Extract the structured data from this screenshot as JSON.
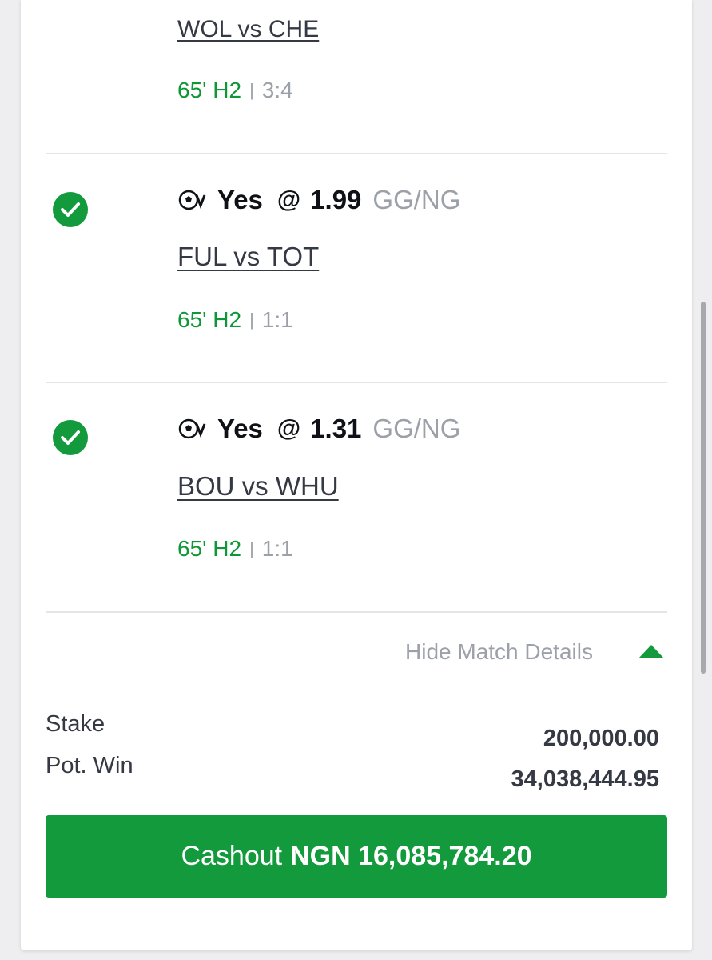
{
  "top_bet": {
    "match": "WOL vs CHE",
    "time": "65' H2",
    "score": "3:4"
  },
  "bets": [
    {
      "status_icon": "check-circle-icon",
      "sport_icon": "football-virtual-icon",
      "pick": "Yes",
      "at": "@",
      "odds": "1.99",
      "market": "GG/NG",
      "match": "FUL vs TOT",
      "time": "65' H2",
      "score": "1:1"
    },
    {
      "status_icon": "check-circle-icon",
      "sport_icon": "football-virtual-icon",
      "pick": "Yes",
      "at": "@",
      "odds": "1.31",
      "market": "GG/NG",
      "match": "BOU vs WHU",
      "time": "65' H2",
      "score": "1:1"
    }
  ],
  "toggle": {
    "label": "Hide Match Details",
    "icon": "caret-up-icon"
  },
  "summary": {
    "stake_label": "Stake",
    "stake_value": "200,000.00",
    "potwin_label": "Pot. Win",
    "potwin_value": "34,038,444.95"
  },
  "cashout": {
    "label": "Cashout",
    "amount": "NGN 16,085,784.20"
  },
  "colors": {
    "accent_green": "#129a3c",
    "live_green": "#0d9737",
    "muted_gray": "#9ca0a8"
  }
}
